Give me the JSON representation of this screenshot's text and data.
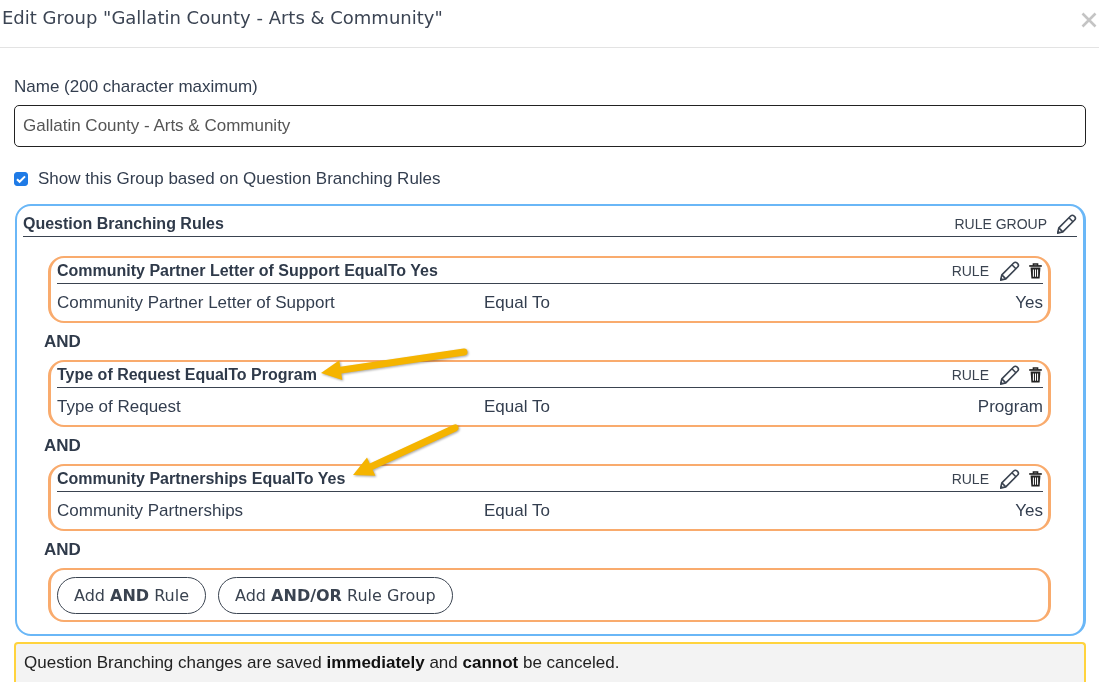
{
  "dialog": {
    "title": "Edit Group \"Gallatin County - Arts & Community\""
  },
  "name_field": {
    "label": "Name (200 character maximum)",
    "value": "Gallatin County - Arts & Community"
  },
  "show_by_rules": {
    "label": "Show this Group based on Question Branching Rules",
    "checked": true
  },
  "rule_group": {
    "title": "Question Branching Rules",
    "tag": "RULE GROUP",
    "rules": [
      {
        "title": "Community Partner Letter of Support EqualTo Yes",
        "tag": "RULE",
        "question": "Community Partner Letter of Support",
        "operator": "Equal To",
        "answer": "Yes",
        "connector": "AND",
        "highlighted": false
      },
      {
        "title": "Type of Request EqualTo Program",
        "tag": "RULE",
        "question": "Type of Request",
        "operator": "Equal To",
        "answer": "Program",
        "connector": "AND",
        "highlighted": true
      },
      {
        "title": "Community Partnerships EqualTo Yes",
        "tag": "RULE",
        "question": "Community Partnerships",
        "operator": "Equal To",
        "answer": "Yes",
        "connector": "AND",
        "highlighted": true
      }
    ],
    "buttons": [
      {
        "label": "Add **AND** Rule"
      },
      {
        "label": "Add **AND/OR** Rule Group"
      }
    ]
  },
  "notice": {
    "text": "Question Branching changes are saved **immediately** and **cannot** be canceled."
  }
}
